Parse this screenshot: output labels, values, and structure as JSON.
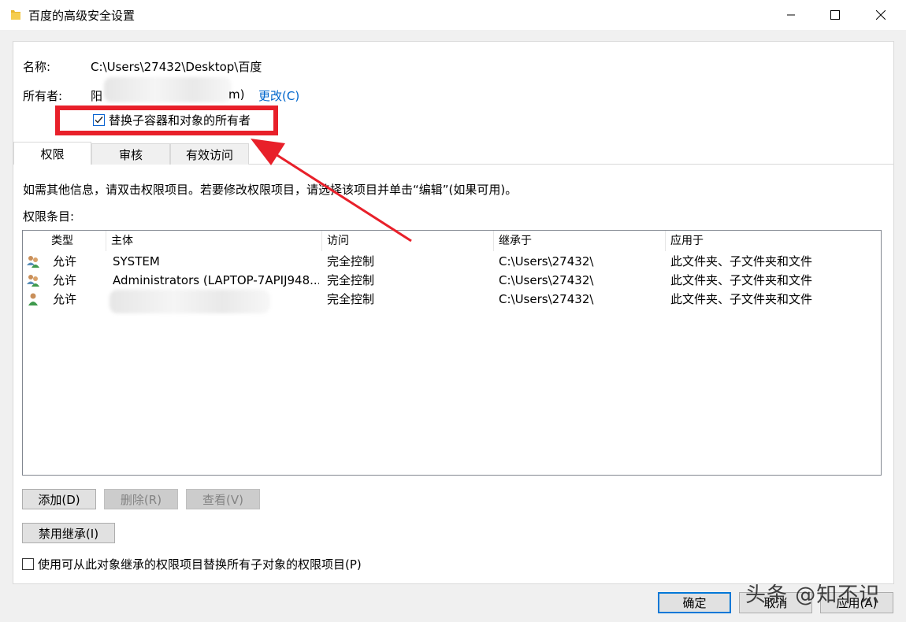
{
  "window": {
    "title": "百度的高级安全设置",
    "icon": "folder-icon"
  },
  "info": {
    "name_label": "名称:",
    "name_value": "C:\\Users\\27432\\Desktop\\百度",
    "owner_label": "所有者:",
    "owner_value_start": "阳",
    "owner_value_end": "m)",
    "change_link": "更改(C)",
    "replace_owner_checkbox": "替换子容器和对象的所有者",
    "replace_owner_checked": true
  },
  "tabs": [
    {
      "label": "权限",
      "active": true
    },
    {
      "label": "审核",
      "active": false
    },
    {
      "label": "有效访问",
      "active": false
    }
  ],
  "instructions": "如需其他信息，请双击权限项目。若要修改权限项目，请选择该项目并单击“编辑”(如果可用)。",
  "entries_label": "权限条目:",
  "table": {
    "columns": [
      "类型",
      "主体",
      "访问",
      "继承于",
      "应用于"
    ],
    "rows": [
      {
        "type": "允许",
        "principal": "SYSTEM",
        "access": "完全控制",
        "inherited": "C:\\Users\\27432\\",
        "applies": "此文件夹、子文件夹和文件",
        "icon": "group-users-icon"
      },
      {
        "type": "允许",
        "principal": "Administrators (LAPTOP-7APIJ948...",
        "access": "完全控制",
        "inherited": "C:\\Users\\27432\\",
        "applies": "此文件夹、子文件夹和文件",
        "icon": "group-users-icon"
      },
      {
        "type": "允许",
        "principal": "",
        "access": "完全控制",
        "inherited": "C:\\Users\\27432\\",
        "applies": "此文件夹、子文件夹和文件",
        "icon": "user-icon"
      }
    ]
  },
  "buttons": {
    "add": "添加(D)",
    "remove": "删除(R)",
    "view": "查看(V)",
    "disable_inheritance": "禁用继承(I)",
    "ok": "确定",
    "cancel": "取消",
    "apply": "应用(A)"
  },
  "replace_child_checkbox": "使用可从此对象继承的权限项目替换所有子对象的权限项目(P)",
  "replace_child_checked": false,
  "watermark": "头条 @知不识",
  "colors": {
    "highlight": "#e8202a",
    "link": "#0066cc",
    "accent": "#0078d7"
  }
}
